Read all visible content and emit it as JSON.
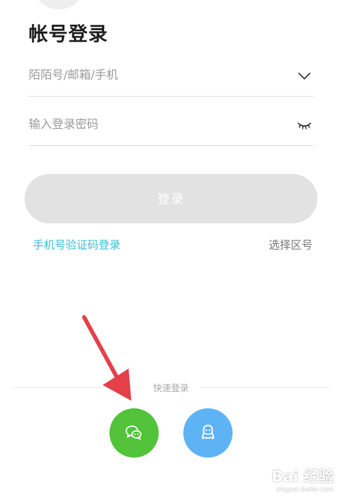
{
  "page": {
    "title": "帐号登录"
  },
  "account_field": {
    "placeholder": "陌陌号/邮箱/手机",
    "value": "",
    "dropdown_icon": "chevron-down-icon"
  },
  "password_field": {
    "placeholder": "输入登录密码",
    "value": "",
    "visibility_icon": "eye-closed-icon"
  },
  "login_button": {
    "label": "登录",
    "state": "disabled"
  },
  "links": {
    "sms_login": "手机号验证码登录",
    "select_region": "选择区号"
  },
  "quick_login": {
    "label": "快速登录",
    "options": [
      {
        "name": "wechat",
        "icon": "wechat-icon",
        "color": "#52c33a"
      },
      {
        "name": "qq",
        "icon": "qq-icon",
        "color": "#5eb3f5"
      }
    ]
  },
  "annotation": {
    "arrow_color": "#e5404a"
  },
  "watermark": {
    "logo_text": "Bai 经验",
    "url": "jingyan.baidu.com"
  },
  "colors": {
    "link_accent": "#3bbcd9",
    "button_disabled": "#e2e2e2"
  }
}
